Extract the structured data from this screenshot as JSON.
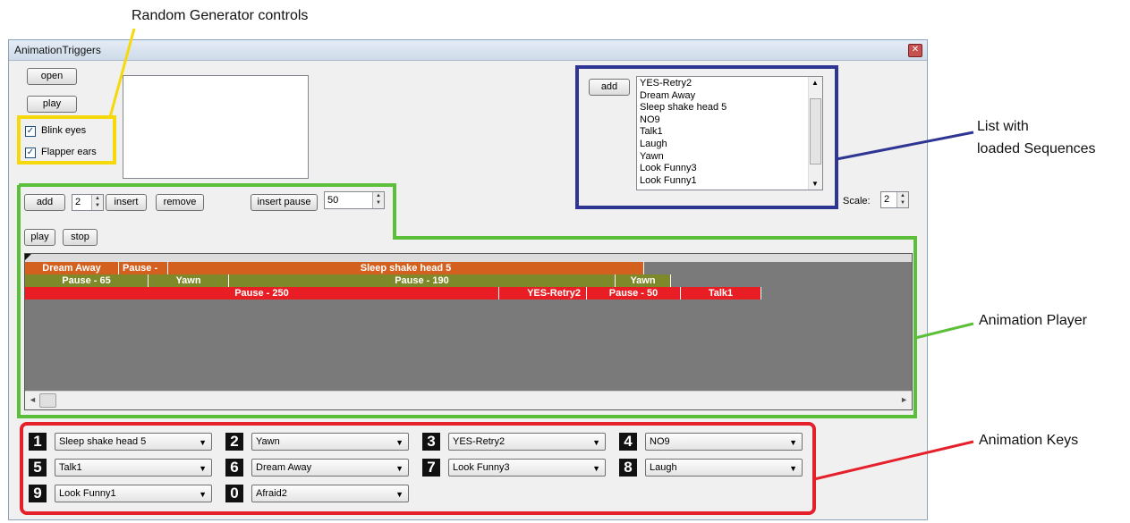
{
  "annotations": {
    "random_generator": "Random Generator controls",
    "list_loaded": [
      "List with",
      "loaded Sequences"
    ],
    "animation_player": "Animation Player",
    "animation_keys": "Animation Keys"
  },
  "window": {
    "title": "AnimationTriggers",
    "close_glyph": "✕"
  },
  "random": {
    "open_label": "open",
    "play_label": "play",
    "blink_label": "Blink eyes",
    "flapper_label": "Flapper ears",
    "check_glyph": "✓"
  },
  "sequences": {
    "add_label": "add",
    "items": [
      "YES-Retry2",
      "Dream Away",
      "Sleep shake head 5",
      "NO9",
      "Talk1",
      "Laugh",
      "Yawn",
      "Look Funny3",
      "Look Funny1"
    ]
  },
  "scale": {
    "label": "Scale:",
    "value": "2"
  },
  "player": {
    "add_label": "add",
    "count_value": "2",
    "insert_label": "insert",
    "remove_label": "remove",
    "insert_pause_label": "insert pause",
    "pause_value": "50",
    "play_label": "play",
    "stop_label": "stop",
    "lanes": [
      [
        "Dream Away",
        "Pause -",
        "Sleep shake head 5"
      ],
      [
        "Pause - 65",
        "Yawn",
        "Pause - 190",
        "Yawn"
      ],
      [
        "Pause - 250",
        "YES-Retry2",
        "Pause - 50",
        "Talk1"
      ]
    ]
  },
  "keys": [
    {
      "num": "1",
      "value": "Sleep shake head 5"
    },
    {
      "num": "2",
      "value": "Yawn"
    },
    {
      "num": "3",
      "value": "YES-Retry2"
    },
    {
      "num": "4",
      "value": "NO9"
    },
    {
      "num": "5",
      "value": "Talk1"
    },
    {
      "num": "6",
      "value": "Dream Away"
    },
    {
      "num": "7",
      "value": "Look Funny3"
    },
    {
      "num": "8",
      "value": "Laugh"
    },
    {
      "num": "9",
      "value": "Look Funny1"
    },
    {
      "num": "0",
      "value": "Afraid2"
    }
  ],
  "colors": {
    "yellow": "#f5d90a",
    "blue": "#2e3592",
    "green": "#5cbf3a",
    "red": "#e5202a",
    "orange": "#d4601f",
    "olive": "#7e8a2a",
    "clip_red": "#e81e24"
  }
}
